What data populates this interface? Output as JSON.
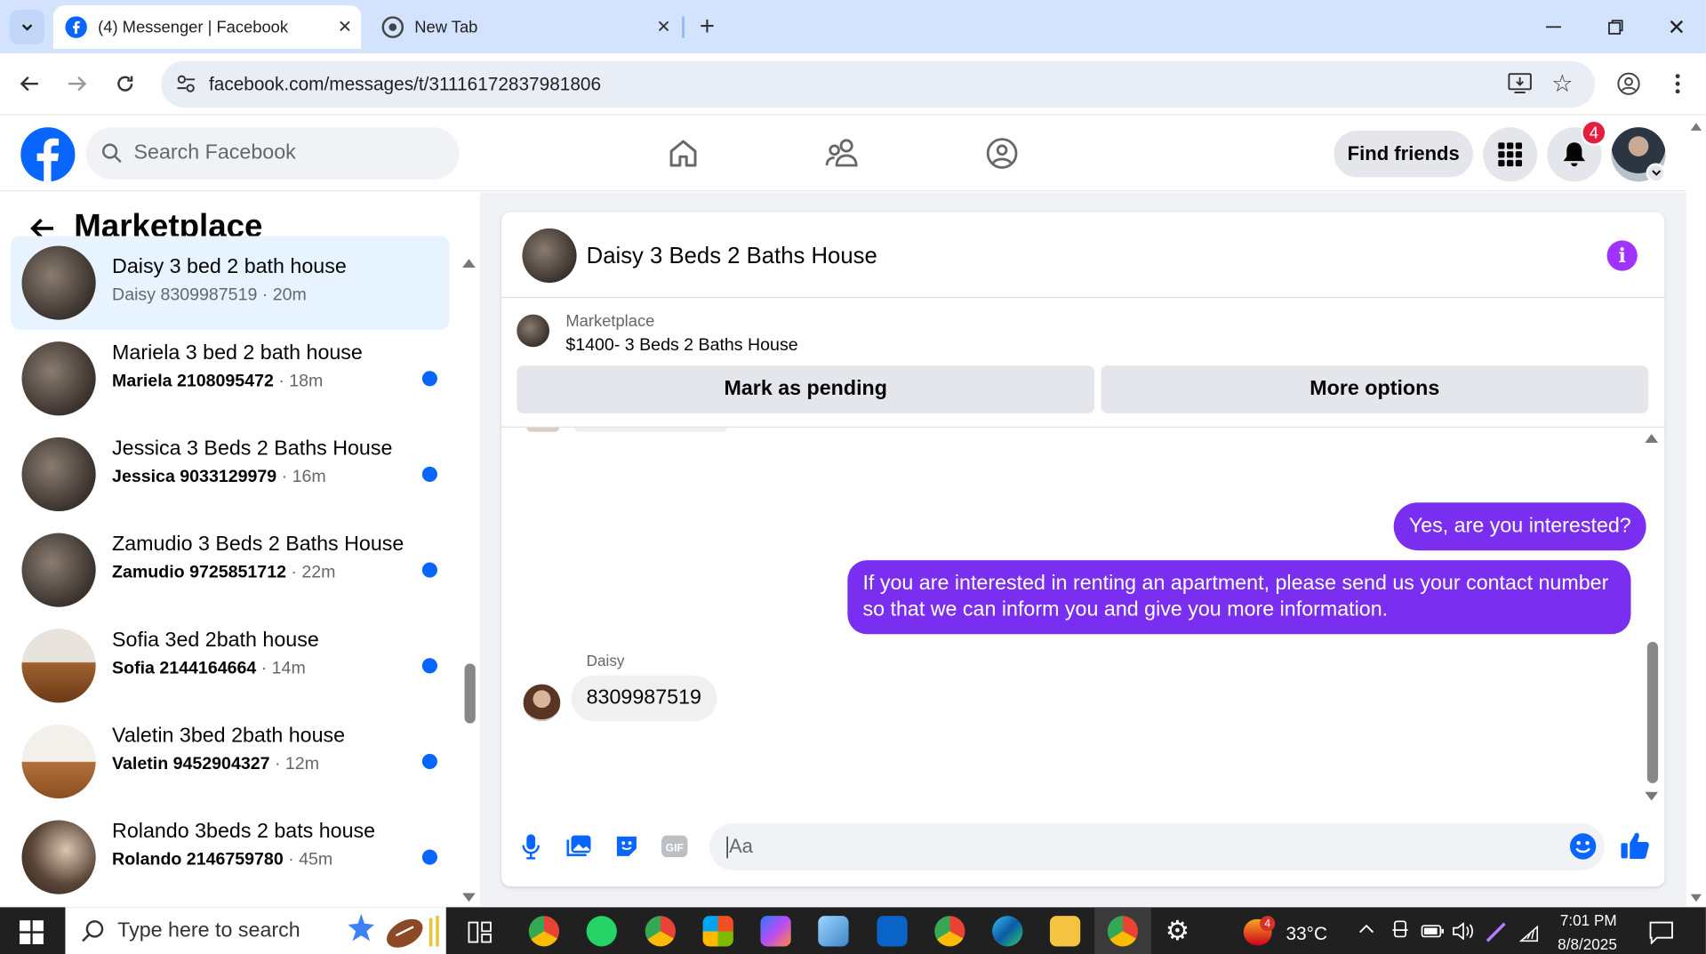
{
  "browser": {
    "tabs": [
      {
        "title": "(4) Messenger | Facebook"
      },
      {
        "title": "New Tab"
      }
    ],
    "url": "facebook.com/messages/t/31116172837981806"
  },
  "facebook": {
    "search_placeholder": "Search Facebook",
    "find_friends": "Find friends",
    "notifications_count": "4"
  },
  "sidebar": {
    "title": "Marketplace",
    "conversations": [
      {
        "name": "Daisy 3 bed 2 bath house",
        "contact": "Daisy 8309987519",
        "time": "20m",
        "unread": false,
        "active": true
      },
      {
        "name": "Mariela 3 bed 2 bath house",
        "contact": "Mariela 2108095472",
        "time": "18m",
        "unread": true
      },
      {
        "name": "Jessica 3 Beds 2 Baths House",
        "contact": "Jessica 9033129979",
        "time": "16m",
        "unread": true
      },
      {
        "name": "Zamudio 3 Beds 2 Baths House",
        "contact": "Zamudio 9725851712",
        "time": "22m",
        "unread": true
      },
      {
        "name": "Sofia 3ed 2bath house",
        "contact": "Sofia 2144164664",
        "time": "14m",
        "unread": true
      },
      {
        "name": "Valetin 3bed 2bath house",
        "contact": "Valetin 9452904327",
        "time": "12m",
        "unread": true
      },
      {
        "name": "Rolando 3beds 2 bats house",
        "contact": "Rolando 2146759780",
        "time": "45m",
        "unread": true
      }
    ]
  },
  "chat": {
    "title": "Daisy 3 Beds 2 Baths House",
    "listing": {
      "label": "Marketplace",
      "title": "$1400- 3 Beds 2 Baths House"
    },
    "mark_pending": "Mark as pending",
    "more_options": "More options",
    "messages": [
      {
        "from": "me",
        "text": "Yes, are you interested?"
      },
      {
        "from": "me",
        "text": "If you are interested in renting an apartment, please send us your contact number so that we can inform you and give you more information."
      },
      {
        "from": "Daisy",
        "sender_label": "Daisy",
        "text": "8309987519"
      }
    ],
    "composer_placeholder": "Aa"
  },
  "taskbar": {
    "search_placeholder": "Type here to search",
    "weather_badge": "4",
    "temperature": "33°C",
    "time": "7:01 PM",
    "date": "8/8/2025"
  },
  "colors": {
    "fb_blue": "#0866ff",
    "accent_purple": "#7a2ff0",
    "active_row": "#e7f3ff",
    "tabbar": "#d3e3fd",
    "badge": "#e41e3f"
  }
}
